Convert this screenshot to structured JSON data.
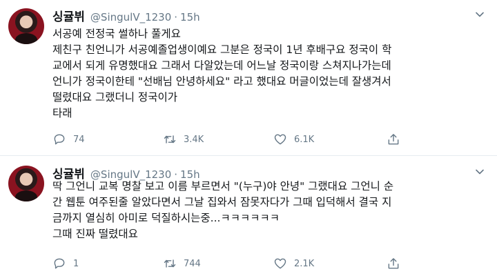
{
  "tweets": [
    {
      "name": "싱귤뷔",
      "handle": "@SingulV_1230",
      "dot": "·",
      "time": "15h",
      "lines": [
        "서공예 전정국 썰하나 풀게요",
        "제친구 친언니가 서공예졸업생이예요 그분은 정국이 1년 후배구요 정국이 학",
        "교에서 되게 유명했대요 그래서 다알았는데 어느날 정국이랑 스쳐지나가는데",
        "언니가 정국이한테 \"선배님 안녕하세요\" 라고 했대요 머글이었는데 잘생겨서",
        "떨렸대요 그랬더니 정국이가",
        "타래"
      ],
      "replies": "74",
      "retweets": "3.4K",
      "likes": "6.1K"
    },
    {
      "name": "싱귤뷔",
      "handle": "@SingulV_1230",
      "dot": "·",
      "time": "15h",
      "lines": [
        "딱 그언니 교복 명찰 보고 이름 부르면서 \"(누구)야 안녕\" 그랬대요 그언니 순",
        "간 웹툰 여주된줄 알았다면서 그날 집와서 잠못자다가 그때 입덕해서 결국 지",
        "금까지 열심히 아미로 덕질하시는중...ㅋㅋㅋㅋㅋㅋ",
        "그때 진짜 떨렸대요"
      ],
      "replies": "1",
      "retweets": "744",
      "likes": "2.1K"
    }
  ],
  "icons": {
    "reply": "reply-icon",
    "retweet": "retweet-icon",
    "like": "like-icon",
    "share": "share-icon",
    "chevron": "chevron-down-icon"
  },
  "colors": {
    "icon": "#657786",
    "text": "#14171a",
    "divider": "#e6ecf0"
  }
}
